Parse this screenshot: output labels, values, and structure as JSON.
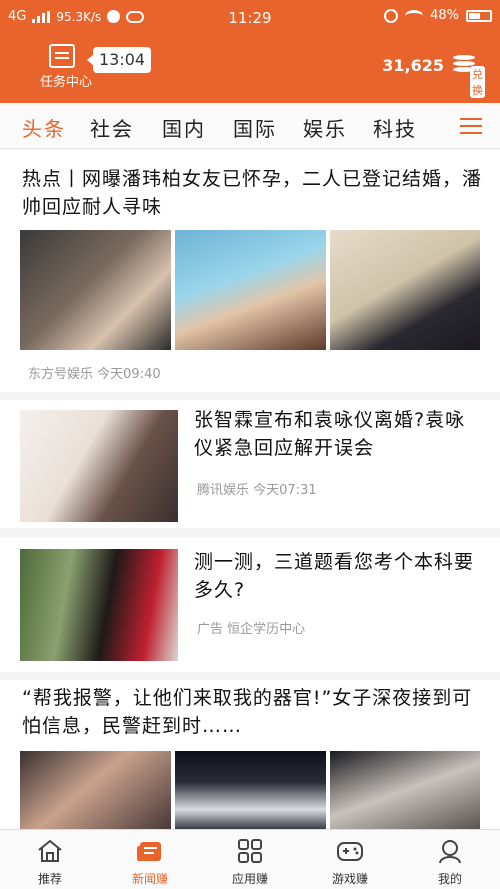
{
  "status_bar": {
    "network": "4G",
    "speed": "95.3K/s",
    "time": "11:29",
    "battery": "48%"
  },
  "header": {
    "task_center_label": "任务中心",
    "timer": "13:04",
    "coins": "31,625",
    "exchange_label": "兑换",
    "colors": {
      "brand": "#e8642c"
    }
  },
  "tabs": [
    "头条",
    "社会",
    "国内",
    "国际",
    "娱乐",
    "科技"
  ],
  "articles": [
    {
      "title": "热点丨网曝潘玮柏女友已怀孕，二人已登记结婚，潘帅回应耐人寻味",
      "source": "东方号娱乐",
      "time": "今天09:40"
    },
    {
      "title": "张智霖宣布和袁咏仪离婚?袁咏仪紧急回应解开误会",
      "source": "腾讯娱乐",
      "time": "今天07:31"
    },
    {
      "title": "测一测，三道题看您考个本科要多久?",
      "source": "广告 恒企学历中心",
      "time": ""
    },
    {
      "title": "“帮我报警，让他们来取我的器官!”女子深夜接到可怕信息，民警赶到时……",
      "source": "",
      "time": ""
    }
  ],
  "bottom_nav": [
    {
      "label": "推荐",
      "icon": "home-icon"
    },
    {
      "label": "新闻赚",
      "icon": "news-icon"
    },
    {
      "label": "应用赚",
      "icon": "apps-icon"
    },
    {
      "label": "游戏赚",
      "icon": "gamepad-icon"
    },
    {
      "label": "我的",
      "icon": "profile-icon"
    }
  ]
}
